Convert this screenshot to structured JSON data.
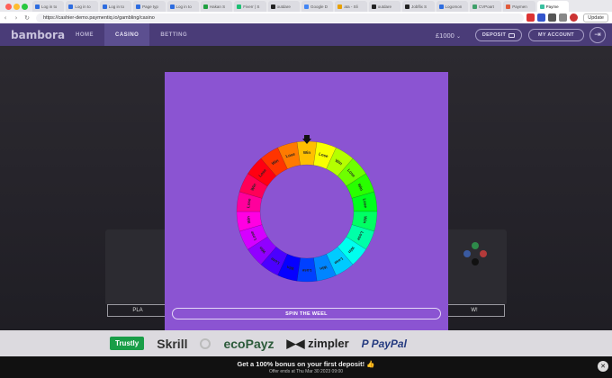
{
  "browser": {
    "tabs": [
      {
        "label": "Log in to",
        "icon": "atlassian-icon",
        "color": "#2d6cdf"
      },
      {
        "label": "Log in to",
        "icon": "atlassian-icon",
        "color": "#2d6cdf"
      },
      {
        "label": "Log in to",
        "icon": "atlassian-icon",
        "color": "#2d6cdf"
      },
      {
        "label": "Page typ",
        "icon": "page-icon",
        "color": "#2d6cdf"
      },
      {
        "label": "Log in to",
        "icon": "atlassian-icon",
        "color": "#2d6cdf"
      },
      {
        "label": "Hakan S",
        "icon": "green-dot-icon",
        "color": "#20a040"
      },
      {
        "label": "Fiverr | S",
        "icon": "fiverr-icon",
        "color": "#1dbf73"
      },
      {
        "label": "outdare",
        "icon": "github-icon",
        "color": "#222222"
      },
      {
        "label": "Google D",
        "icon": "google-docs-icon",
        "color": "#4285f4"
      },
      {
        "label": "ata - Sli",
        "icon": "slides-icon",
        "color": "#e8a000"
      },
      {
        "label": "outdare",
        "icon": "github-icon",
        "color": "#222222"
      },
      {
        "label": "Jobflix S",
        "icon": "jobflix-icon",
        "color": "#222222"
      },
      {
        "label": "Logomon",
        "icon": "logo-icon",
        "color": "#2d6cdf"
      },
      {
        "label": "CVPoart",
        "icon": "cv-icon",
        "color": "#3fa06a"
      },
      {
        "label": "Paymen",
        "icon": "payment-icon",
        "color": "#e05a3a"
      },
      {
        "label": "Payme",
        "icon": "payment-icon",
        "color": "#3ac0a0",
        "active": true
      }
    ],
    "url": "https://cashier-demo.paymentiq.io/gambling/casino",
    "update_label": "Update"
  },
  "nav": {
    "logo": "bambora",
    "items": [
      {
        "label": "HOME",
        "active": false
      },
      {
        "label": "CASINO",
        "active": true
      },
      {
        "label": "BETTING",
        "active": false
      }
    ],
    "balance": "£1000",
    "deposit_label": "DEPOSIT",
    "account_label": "MY ACCOUNT"
  },
  "modal": {
    "wheel_segments": [
      "Win",
      "Lose",
      "Win",
      "Lose",
      "Win",
      "Lose",
      "Win",
      "Lose",
      "Win",
      "Lose",
      "Win",
      "Lose",
      "Win",
      "Lose",
      "Win",
      "Lose",
      "Win",
      "Lose",
      "Win",
      "Lose",
      "Win",
      "Lose"
    ],
    "spin_label": "SPIN THE WEEL"
  },
  "background_cards": {
    "left_button": "PLA",
    "right_button": "W!"
  },
  "payments": {
    "trustly": "Trustly",
    "skrill": "Skrill",
    "ecopayz": "ecoPayz",
    "zimpler": "zimpler",
    "paypal": "PayPal"
  },
  "bonus": {
    "headline": "Get a 100% bonus on your first deposit!",
    "subline": "Offer ends at Thu Mar 30 2023 09:00"
  },
  "colors": {
    "modal_bg": "#8b54d2",
    "nav_bg": "#4a3c78",
    "trustly_green": "#1a9e48"
  }
}
